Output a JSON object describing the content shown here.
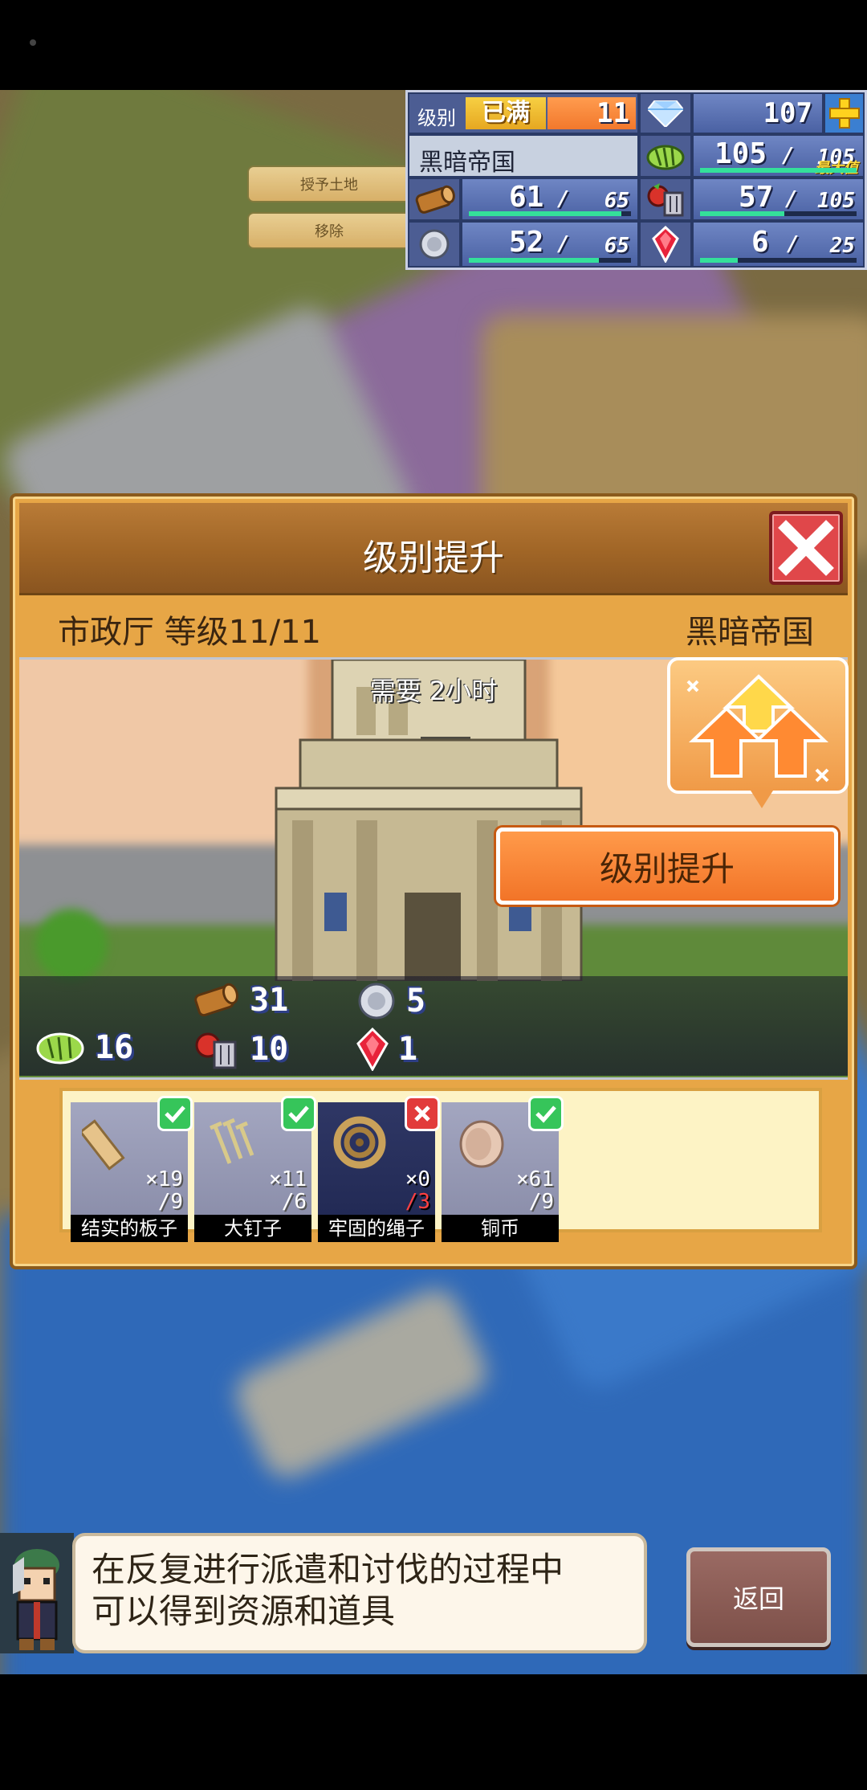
{
  "land_menu": {
    "grant": "授予土地",
    "remove": "移除"
  },
  "hud": {
    "level_label": "级别",
    "level_full": "已满",
    "level_value": "11",
    "gems": "107",
    "kingdom_name": "黑暗帝国",
    "crops": {
      "current": "105",
      "max": "105",
      "max_tag": "最大值",
      "fill": 1.0
    },
    "wood": {
      "current": "61",
      "max": "65",
      "fill": 0.94
    },
    "food": {
      "current": "57",
      "max": "105",
      "fill": 0.54
    },
    "ore": {
      "current": "52",
      "max": "65",
      "fill": 0.8
    },
    "mana": {
      "current": "6",
      "max": "25",
      "fill": 0.24
    },
    "slash": "/"
  },
  "dialog": {
    "title": "级别提升",
    "building": "市政厅 等级11/11",
    "kingdom": "黑暗帝国",
    "time_required": "需要 2小时",
    "costs": {
      "wood": "31",
      "ore": "5",
      "crops": "16",
      "food": "10",
      "mana": "1"
    },
    "upgrade_button": "级别提升",
    "materials": [
      {
        "name": "结实的板子",
        "have": "×19",
        "need": "/9",
        "ok": true
      },
      {
        "name": "大钉子",
        "have": "×11",
        "need": "/6",
        "ok": true
      },
      {
        "name": "牢固的绳子",
        "have": "×0",
        "need": "/3",
        "ok": false
      },
      {
        "name": "铜币",
        "have": "×61",
        "need": "/9",
        "ok": true
      }
    ]
  },
  "hint": {
    "line1": "在反复进行派遣和讨伐的过程中",
    "line2": "可以得到资源和道具"
  },
  "back_button": "返回",
  "colors": {
    "hud_bg": "#2a3a66",
    "bar": "#34e09a",
    "dialog": "#e7a646",
    "upgrade": "#f27428",
    "close": "#e0474a"
  },
  "icons": [
    "diamond-icon",
    "plus-icon",
    "crops-icon",
    "wood-icon",
    "food-icon",
    "ore-icon",
    "mana-icon",
    "check-icon",
    "cross-icon",
    "upgrade-arrows-icon"
  ]
}
